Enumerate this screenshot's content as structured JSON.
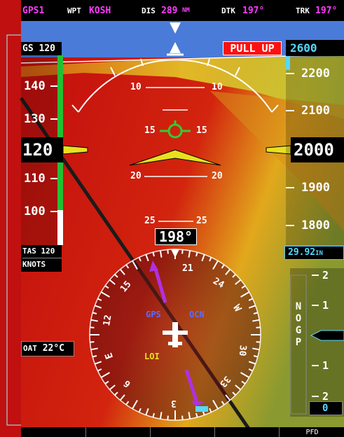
{
  "nav_status": {
    "gps_source": "GPS1",
    "wpt_label": "WPT",
    "wpt_value": "KOSH",
    "dis_label": "DIS",
    "dis_value": "289",
    "dis_unit": "NM",
    "dtk_label": "DTK",
    "dtk_value": "197°",
    "trk_label": "TRK",
    "trk_value": "197°"
  },
  "airspeed": {
    "gs_label": "GS",
    "gs_value": "120",
    "current": "120",
    "tape_labels": [
      "140",
      "130",
      "110",
      "100"
    ],
    "tas_label": "TAS",
    "tas_value": "120",
    "units": "KNOTS"
  },
  "altitude": {
    "selected": "2600",
    "current": "2000",
    "tape_labels": [
      "2200",
      "2100",
      "1900",
      "1800"
    ],
    "baro_value": "29.92",
    "baro_unit": "IN"
  },
  "vsi": {
    "glidepath_text": "NO GP",
    "labels": [
      "2",
      "1",
      "1",
      "2"
    ],
    "value": "0"
  },
  "warning": {
    "pull_up": "PULL UP"
  },
  "attitude": {
    "pitch_labels": [
      "10",
      "10",
      "15",
      "15",
      "20",
      "20",
      "25",
      "25"
    ]
  },
  "heading": {
    "current": "198°",
    "compass_labels": [
      "21",
      "24",
      "W",
      "30",
      "33",
      "3",
      "6",
      "E",
      "12",
      "15"
    ],
    "cdi_source": "GPS",
    "flight_phase": "OCN",
    "loi": "LOI"
  },
  "oat": {
    "label": "OAT",
    "value": "22°C"
  },
  "softkeys": {
    "ped": "PFD"
  },
  "colors": {
    "magenta": "#ff3cff",
    "cyan": "#55d8ff",
    "warning_red": "#ff1010",
    "speed_green": "#22c033",
    "sky": "#4a7bd8"
  }
}
